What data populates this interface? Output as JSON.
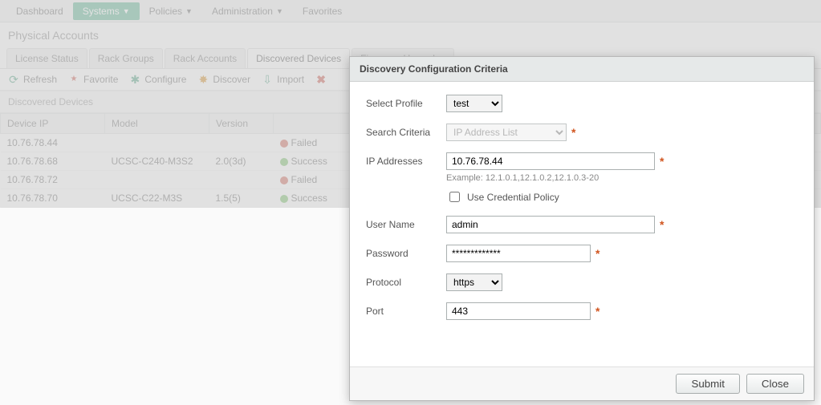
{
  "topnav": {
    "dashboard": "Dashboard",
    "systems": "Systems",
    "policies": "Policies",
    "administration": "Administration",
    "favorites": "Favorites"
  },
  "page_title": "Physical Accounts",
  "tabs": {
    "license": "License Status",
    "rack_groups": "Rack Groups",
    "rack_accounts": "Rack Accounts",
    "discovered": "Discovered Devices",
    "firmware": "Firmware Upgrades"
  },
  "toolbar": {
    "refresh": "Refresh",
    "favorite": "Favorite",
    "configure": "Configure",
    "discover": "Discover",
    "import": "Import"
  },
  "grid_title": "Discovered Devices",
  "columns": {
    "ip": "Device IP",
    "model": "Model",
    "version": "Version",
    "status": ""
  },
  "rows": [
    {
      "ip": "10.76.78.44",
      "model": "",
      "version": "",
      "status": "Failed",
      "ok": false
    },
    {
      "ip": "10.76.78.68",
      "model": "UCSC-C240-M3S2",
      "version": "2.0(3d)",
      "status": "Success",
      "ok": true
    },
    {
      "ip": "10.76.78.72",
      "model": "",
      "version": "",
      "status": "Failed",
      "ok": false
    },
    {
      "ip": "10.76.78.70",
      "model": "UCSC-C22-M3S",
      "version": "1.5(5)",
      "status": "Success",
      "ok": true
    }
  ],
  "modal": {
    "title": "Discovery Configuration Criteria",
    "select_profile_label": "Select Profile",
    "select_profile_value": "test",
    "search_criteria_label": "Search Criteria",
    "search_criteria_value": "IP Address List",
    "ip_label": "IP Addresses",
    "ip_value": "10.76.78.44",
    "ip_hint": "Example: 12.1.0.1,12.1.0.2,12.1.0.3-20",
    "use_cred_label": "Use Credential Policy",
    "username_label": "User Name",
    "username_value": "admin",
    "password_label": "Password",
    "password_value": "*************",
    "protocol_label": "Protocol",
    "protocol_value": "https",
    "port_label": "Port",
    "port_value": "443",
    "submit": "Submit",
    "close": "Close"
  }
}
